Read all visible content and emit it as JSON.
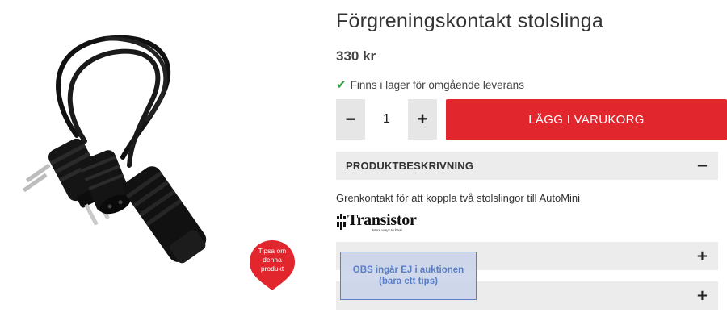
{
  "product": {
    "title": "Förgreningskontakt stolslinga",
    "price": "330 kr",
    "stock_text": "Finns i lager för omgående leverans",
    "stock_icon": "check-icon",
    "stock_color": "#2e9a3e"
  },
  "purchase": {
    "qty_minus": "−",
    "qty_plus": "+",
    "quantity": "1",
    "add_to_cart": "LÄGG I VARUKORG",
    "accent_color": "#e1262d"
  },
  "tip_badge": {
    "line1": "Tipsa om",
    "line2": "denna",
    "line3": "produkt"
  },
  "accordion": {
    "description_label": "PRODUKTBESKRIVNING",
    "description_toggle": "−",
    "description_text": "Grenkontakt för att koppla två stolslingor till AutoMini",
    "section2_toggle": "+",
    "section3_toggle": "+"
  },
  "brand": {
    "name": "Transistor",
    "tagline": "More ways to hear"
  },
  "overlay_note": {
    "line1": "OBS ingår EJ i auktionen",
    "line2": "(bara ett tips)"
  }
}
